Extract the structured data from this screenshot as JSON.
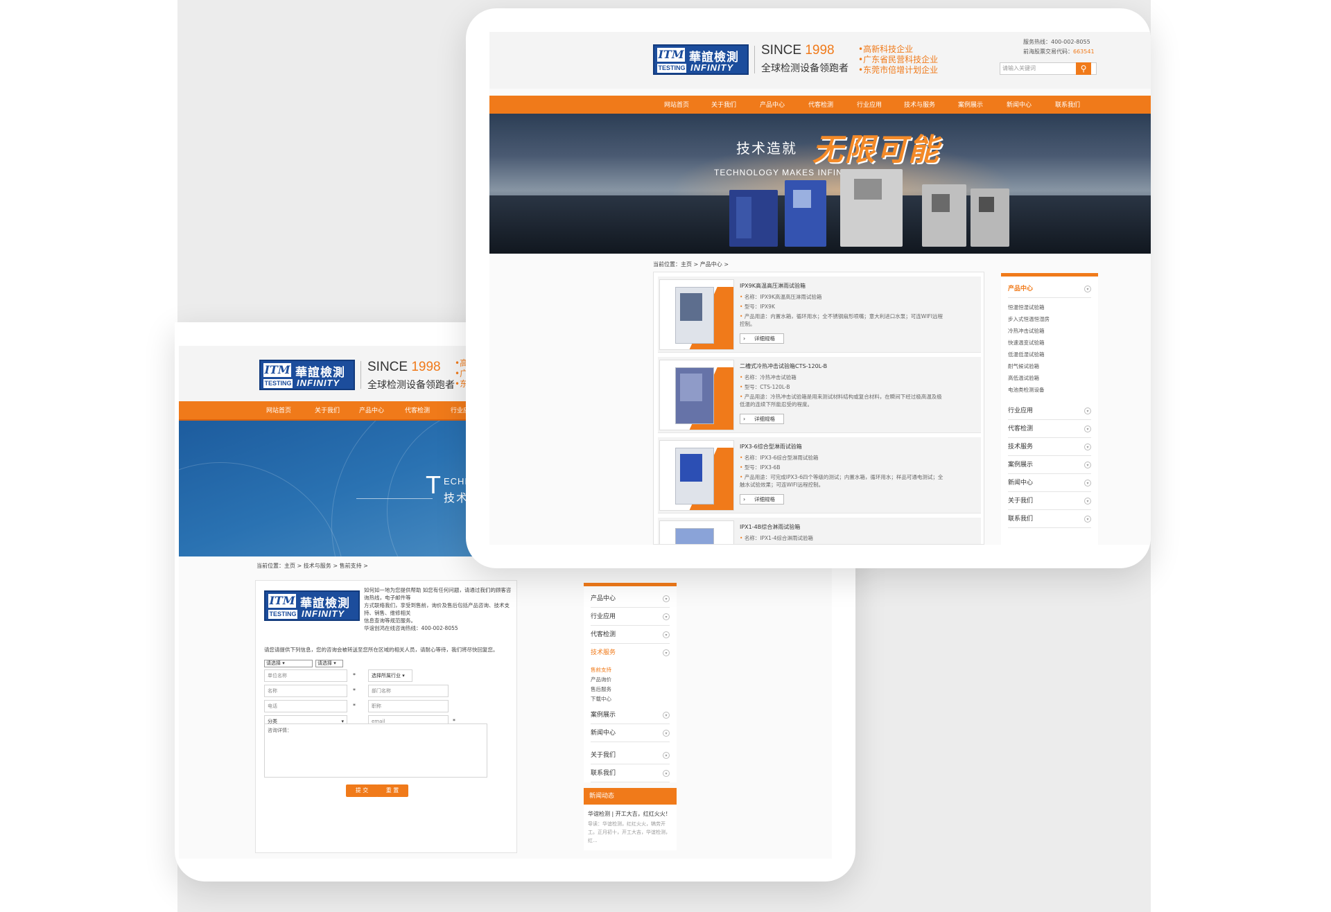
{
  "brand": {
    "logo_cn": "華誼檢測",
    "logo_itm": "ITM",
    "logo_testing": "TESTING",
    "logo_infinity": "INFINITY",
    "since": "SINCE ",
    "since_year": "1998",
    "slogan": "全球检测设备领跑者",
    "tags": [
      "•高新科技企业",
      "•广东省民营科技企业",
      "•东莞市倍增计划企业"
    ],
    "hotline": "服务热线：400-002-8055",
    "stock_label": "前海股票交易代码：",
    "stock_code": "663541",
    "search_placeholder": "请输入关键词",
    "search_icon": "search-icon"
  },
  "nav": {
    "items": [
      "网站首页",
      "关于我们",
      "产品中心",
      "代客检测",
      "行业应用",
      "技术与服务",
      "案例展示",
      "新闻中心",
      "联系我们"
    ]
  },
  "front": {
    "banner": {
      "prefix": "技术造就",
      "headline": "无限可能",
      "en": "TECHNOLOGY MAKES INFINITE POSS"
    },
    "breadcrumb": "当前位置：主页 > 产品中心 >",
    "products": [
      {
        "title": "IPX9K高温高压淋雨试验箱",
        "name": "名称：IPX9K高温高压淋雨试验箱",
        "model": "型号：IPX9K",
        "use1": "产品用途：内置水箱，循环用水；全不锈钢扇形喷嘴；意大利进口水泵；可连WIFI远程",
        "use2": "控制。",
        "button": "详细规格"
      },
      {
        "title": "二槽式冷热冲击试验箱CTS-120L-B",
        "name": "名称：冷热冲击试验箱",
        "model": "型号：CTS-120L-B",
        "use1": "产品用途：冷热冲击试验箱是用来测试材料结构或复合材料，在瞬间下经过极高温及极",
        "use2": "低温的连续下所能忍受的程度。",
        "button": "详细规格"
      },
      {
        "title": "IPX3-6综合型淋雨试验箱",
        "name": "名称：IPX3-6综合型淋雨试验箱",
        "model": "型号：IPX3-6B",
        "use1": "产品用途：可完成IPX3-6四个等级的测试；内置水箱，循环用水；样品可通电测试；全",
        "use2": "触水试验效果；可连WIFI远程控制。",
        "button": "详细规格"
      },
      {
        "title": "IPX1-4B综合淋雨试验箱",
        "name": "名称：IPX1-4综合淋雨试验箱"
      }
    ],
    "sidebar": {
      "heading": "产品中心",
      "subs": [
        "恒温恒湿试验箱",
        "步入式恒温恒湿房",
        "冷热冲击试验箱",
        "快速温变试验箱",
        "低温低湿试验箱",
        "耐气候试验箱",
        "高低温试验箱",
        "电池类检测设备"
      ],
      "items": [
        "行业应用",
        "代客检测",
        "技术服务",
        "案例展示",
        "新闻中心",
        "关于我们",
        "联系我们"
      ]
    }
  },
  "back": {
    "banner": {
      "letter": "T",
      "en": "ECHNO",
      "cn": "技术"
    },
    "breadcrumb": "当前位置：主页 > 技术与服务 > 售前支持 >",
    "intro_lines": [
      "如何如一地为您提供帮助 如您有任何问题，请通过我们的顾客咨询热线，电子邮件等",
      "方式联络我们，享受到售前，询价及售后包括产品咨询、技术支持、销售、维修相关",
      "信息查询等规范服务。",
      "华谊创鸿在线咨询热线：400-002-8055"
    ],
    "note": "请您请提供下列信息，您的咨询会被转送至您所在区域的相关人员，请耐心等待，我们将尽快回复您。",
    "select1": "请选择",
    "select2": "请选择",
    "fields": {
      "company": "单位名称",
      "industry": "选择所属行业",
      "name": "名称",
      "dept": "部门名称",
      "phone": "电话",
      "title": "职称",
      "category": "分类",
      "email": "email",
      "details": "咨询详情："
    },
    "submit": "提 交",
    "reset": "重 置",
    "sidebar": {
      "items_top": [
        "产品中心",
        "行业应用",
        "代客检测"
      ],
      "active": "技术服务",
      "subs": [
        "售前支持",
        "产品询价",
        "售后服务",
        "下载中心"
      ],
      "items_bottom": [
        "案例展示",
        "新闻中心",
        "关于我们",
        "联系我们"
      ]
    },
    "news": {
      "heading": "新闻动态",
      "title": "华谊检测 | 开工大吉，红红火火！",
      "desc": "导读：华谊检测，红红火火，犒劳开工。正月初十，开工大吉，华谊检测，红..."
    }
  },
  "colors": {
    "accent": "#f07a1a",
    "brand_blue": "#1c4d9c"
  }
}
